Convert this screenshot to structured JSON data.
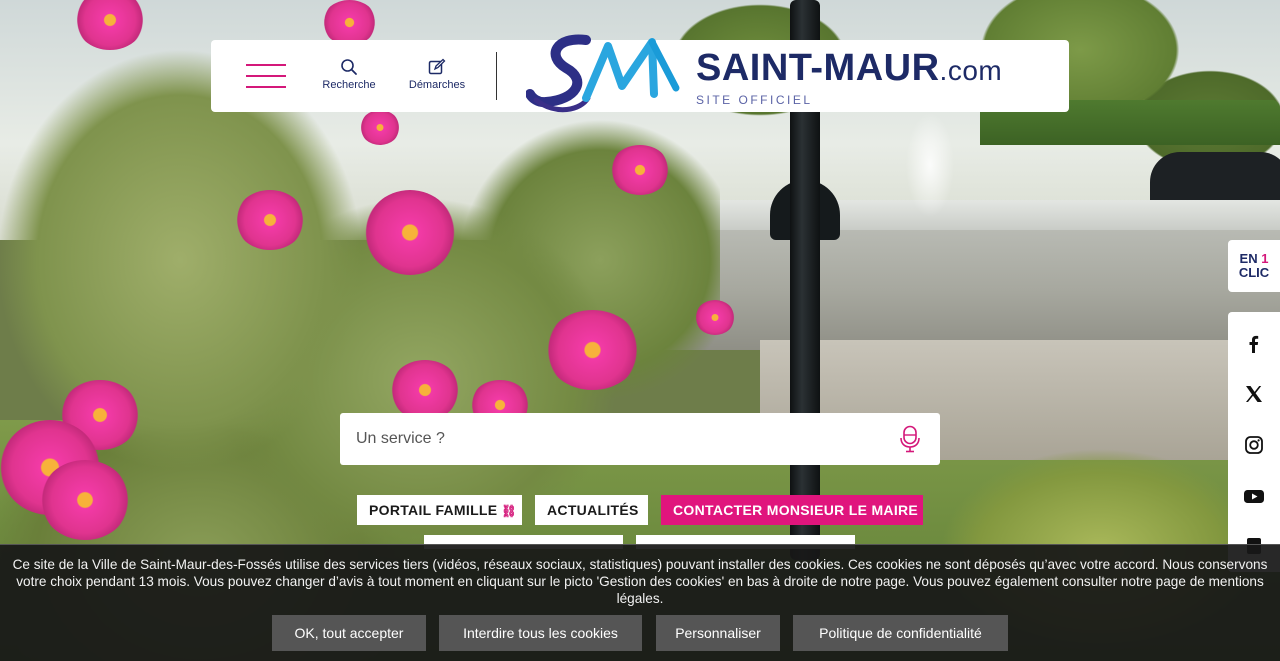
{
  "header": {
    "search_label": "Recherche",
    "demarches_label": "Démarches",
    "logo_main": "SAINT-MAUR",
    "logo_suffix": ".com",
    "logo_sub": "SITE OFFICIEL",
    "colors": {
      "brand_navy": "#1d2a66",
      "brand_pink": "#d4187a"
    }
  },
  "side": {
    "en_label": "EN",
    "one_label": "1",
    "clic_label": "CLIC",
    "social_icons": [
      "facebook-icon",
      "x-twitter-icon",
      "instagram-icon",
      "youtube-icon"
    ]
  },
  "search": {
    "placeholder": "Un service ?"
  },
  "quick_links": {
    "portail_famille": "PORTAIL FAMILLE",
    "actualites": "ACTUALITÉS",
    "contacter_maire": "CONTACTER MONSIEUR LE MAIRE",
    "accent": "#e0157d"
  },
  "cookie": {
    "text": "Ce site de la Ville de Saint-Maur-des-Fossés utilise des services tiers (vidéos, réseaux sociaux, statistiques) pouvant installer des cookies. Ces cookies ne sont déposés qu’avec votre accord. Nous conservons votre choix pendant 13 mois. Vous pouvez changer d’avis à tout moment en cliquant sur le picto 'Gestion des cookies' en bas à droite de notre page. Vous pouvez également consulter notre page de mentions légales.",
    "accept_all": "OK, tout accepter",
    "deny_all": "Interdire tous les cookies",
    "customize": "Personnaliser",
    "privacy_policy": "Politique de confidentialité"
  }
}
